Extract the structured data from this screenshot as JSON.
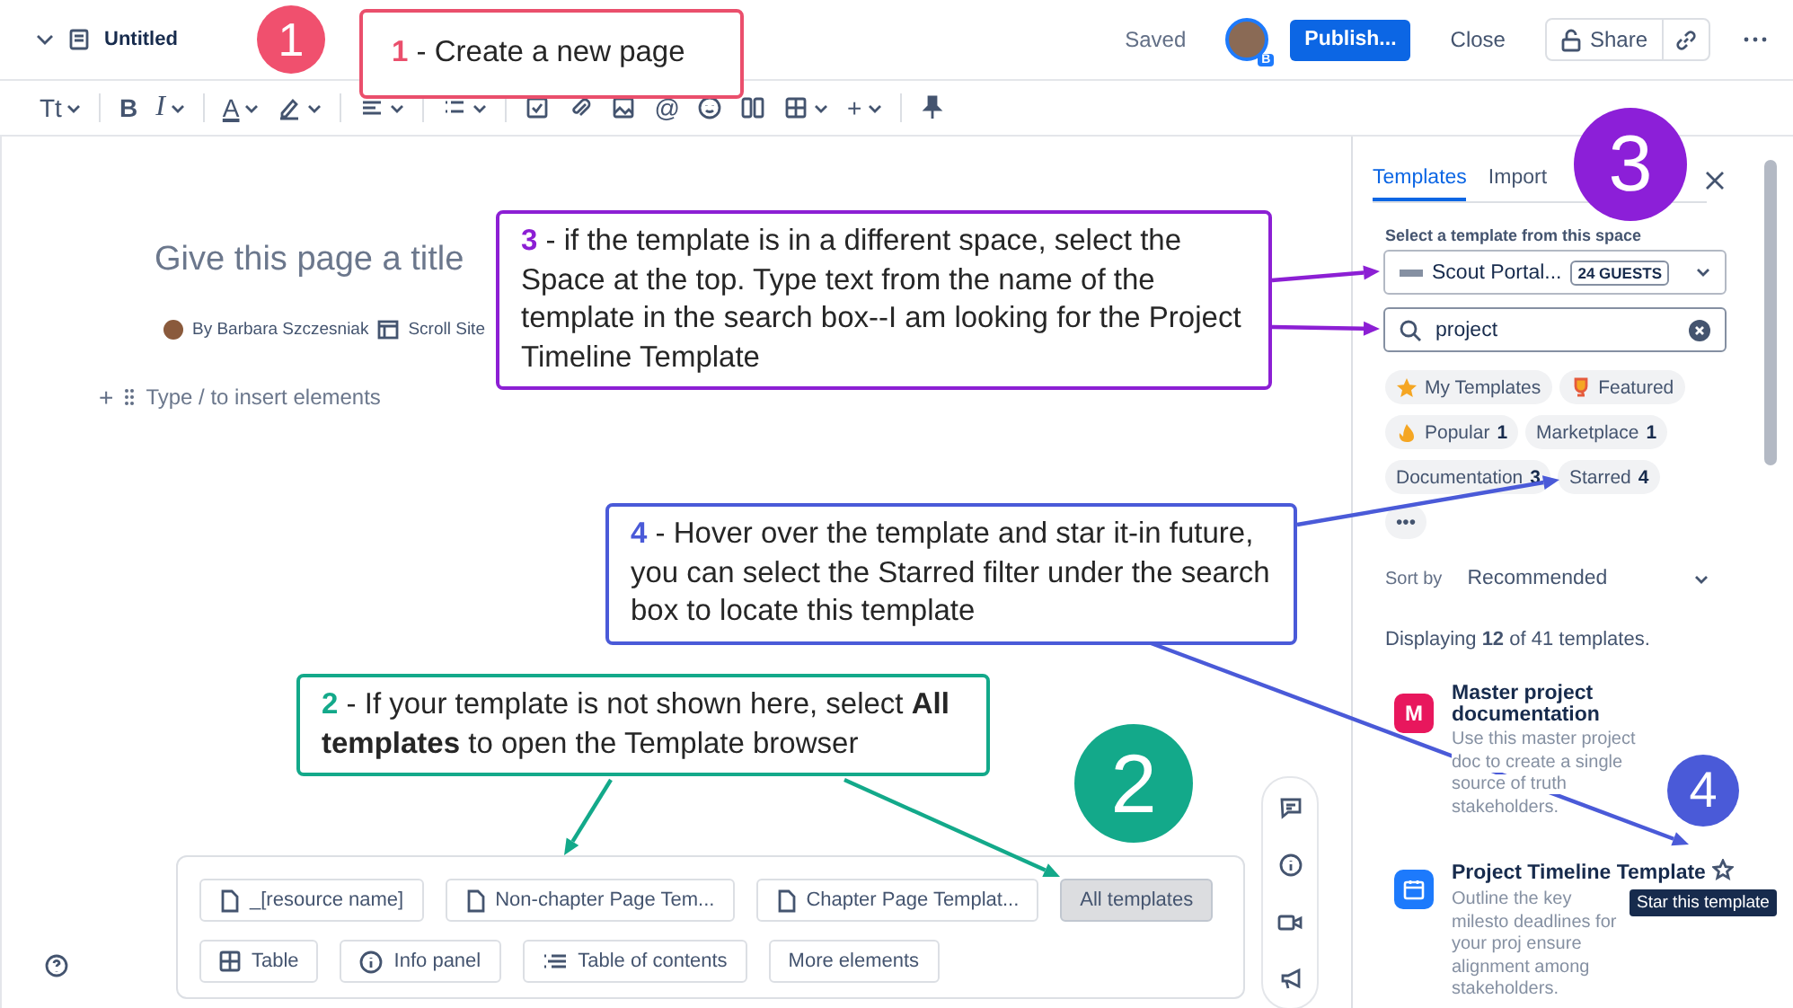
{
  "header": {
    "title": "Untitled",
    "status": "Saved",
    "avatar_badge": "B",
    "publish": "Publish...",
    "close": "Close",
    "share": "Share"
  },
  "toolbar": [
    "Tt",
    "B",
    "I",
    "A",
    "@",
    "+"
  ],
  "editor": {
    "title_placeholder": "Give this page a title",
    "author": "By Barbara Szczesniak",
    "site": "Scroll Site",
    "insert_placeholder": "Type / to insert elements",
    "insert_plus": "+"
  },
  "template_buttons": [
    {
      "label": "_[resource name]",
      "kind": "page",
      "selected": false
    },
    {
      "label": "Non-chapter Page Tem...",
      "kind": "page",
      "selected": false
    },
    {
      "label": "Chapter Page Templat...",
      "kind": "page",
      "selected": false
    },
    {
      "label": "All templates",
      "kind": "plain",
      "selected": true
    },
    {
      "label": "Table",
      "kind": "table",
      "selected": false
    },
    {
      "label": "Info panel",
      "kind": "info",
      "selected": false
    },
    {
      "label": "Table of contents",
      "kind": "toc",
      "selected": false
    },
    {
      "label": "More elements",
      "kind": "plain",
      "selected": false
    }
  ],
  "panel": {
    "tabs": [
      {
        "label": "Templates",
        "selected": true
      },
      {
        "label": "Import",
        "selected": false
      }
    ],
    "space_label": "Select a template from this space",
    "space": "Scout Portal...",
    "space_badge": "24 GUESTS",
    "search": "project",
    "chips": [
      {
        "label": "My Templates",
        "kind": "star"
      },
      {
        "label": "Featured",
        "kind": "trophy"
      },
      {
        "label": "Popular",
        "count": "1",
        "kind": "flame"
      },
      {
        "label": "Marketplace",
        "count": "1",
        "kind": "plain"
      },
      {
        "label": "Documentation",
        "count": "3",
        "kind": "plain"
      },
      {
        "label": "Starred",
        "count": "4",
        "kind": "plain"
      },
      {
        "label": "•••",
        "kind": "more"
      }
    ],
    "sort_label": "Sort by",
    "sort_value": "Recommended",
    "displaying": "Displaying **12** of 41 templates.",
    "templates": [
      {
        "title": "Master project documentation",
        "description": "Use this master project doc to create a single source of truth stakeholders.",
        "kind": "letter",
        "letter": "M",
        "color": "#e8175d",
        "hovered": false
      },
      {
        "title": "Project Timeline Template",
        "description": "Outline the key milesto deadlines for your proj ensure alignment among stakeholders.",
        "kind": "calendar",
        "color": "#1d7afc",
        "hovered": true,
        "tooltip": "Star this template"
      }
    ]
  },
  "callouts": [
    {
      "number": "1",
      "text": "- Create a new page",
      "color": "#ea4f6c"
    },
    {
      "number": "3",
      "text": "- if the template is in a different space, select the Space at the top. Type text from the name of the template in the search box--I am looking for the Project Timeline Template",
      "color": "#8c1fd4"
    },
    {
      "number": "4",
      "text": "- Hover over the template and star it-in future, you can select the Starred filter under the search box to locate this template",
      "color": "#4a5ad8"
    },
    {
      "number": "2",
      "text": "- If your template is not shown here, select **All templates** to open the Template browser",
      "color": "#13a98a"
    }
  ],
  "step_circles": [
    {
      "label": "1",
      "color": "#f0506e"
    },
    {
      "label": "2",
      "color": "#13a98a"
    },
    {
      "label": "3",
      "color": "#8c1fd8"
    },
    {
      "label": "4",
      "color": "#4a5ad8"
    }
  ]
}
